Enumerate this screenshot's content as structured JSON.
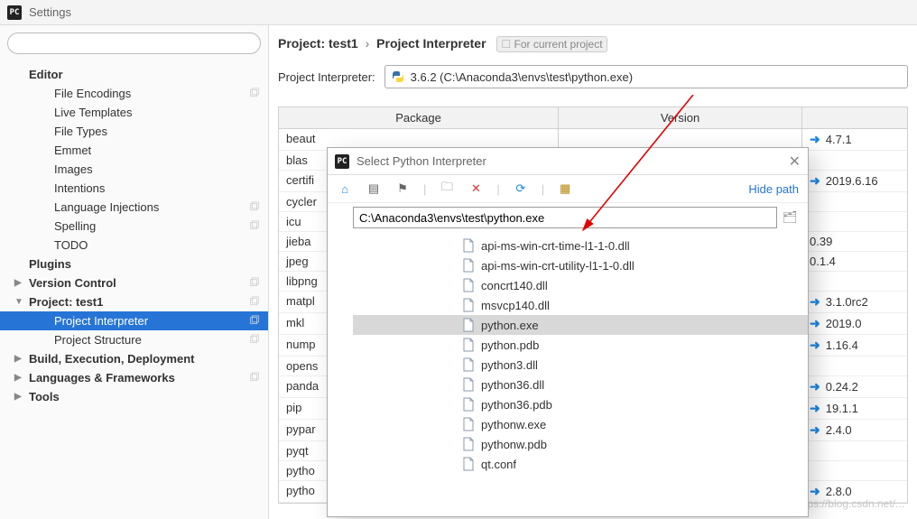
{
  "title": "Settings",
  "sidebar": {
    "items": [
      {
        "label": "Editor",
        "type": "head"
      },
      {
        "label": "File Encodings",
        "type": "child",
        "copy": true
      },
      {
        "label": "Live Templates",
        "type": "child"
      },
      {
        "label": "File Types",
        "type": "child"
      },
      {
        "label": "Emmet",
        "type": "child"
      },
      {
        "label": "Images",
        "type": "child"
      },
      {
        "label": "Intentions",
        "type": "child"
      },
      {
        "label": "Language Injections",
        "type": "child",
        "copy": true
      },
      {
        "label": "Spelling",
        "type": "child",
        "copy": true
      },
      {
        "label": "TODO",
        "type": "child"
      },
      {
        "label": "Plugins",
        "type": "head"
      },
      {
        "label": "Version Control",
        "type": "exp",
        "copy": true
      },
      {
        "label": "Project: test1",
        "type": "open",
        "copy": true
      },
      {
        "label": "Project Interpreter",
        "type": "child",
        "sel": true,
        "copy": true
      },
      {
        "label": "Project Structure",
        "type": "child",
        "copy": true
      },
      {
        "label": "Build, Execution, Deployment",
        "type": "exp"
      },
      {
        "label": "Languages & Frameworks",
        "type": "exp",
        "copy": true
      },
      {
        "label": "Tools",
        "type": "exp"
      }
    ]
  },
  "breadcrumb": {
    "a": "Project: test1",
    "b": "Project Interpreter",
    "badge": "For current project"
  },
  "interp": {
    "label": "Project Interpreter:",
    "value": "3.6.2 (C:\\Anaconda3\\envs\\test\\python.exe)"
  },
  "table": {
    "heads": [
      "Package",
      "Version",
      ""
    ],
    "rows": [
      {
        "pkg": "beaut",
        "ver": "",
        "lat": "4.7.1",
        "arrow": true
      },
      {
        "pkg": "blas",
        "ver": "",
        "lat": ""
      },
      {
        "pkg": "certifi",
        "ver": "",
        "lat": "2019.6.16",
        "arrow": true
      },
      {
        "pkg": "cycler",
        "ver": "",
        "lat": ""
      },
      {
        "pkg": "icu",
        "ver": "",
        "lat": ""
      },
      {
        "pkg": "jieba",
        "ver": "",
        "lat": "0.39"
      },
      {
        "pkg": "jpeg",
        "ver": "",
        "lat": "0.1.4"
      },
      {
        "pkg": "libpng",
        "ver": "",
        "lat": ""
      },
      {
        "pkg": "matpl",
        "ver": "",
        "lat": "3.1.0rc2",
        "arrow": true
      },
      {
        "pkg": "mkl",
        "ver": "",
        "lat": "2019.0",
        "arrow": true
      },
      {
        "pkg": "nump",
        "ver": "",
        "lat": "1.16.4",
        "arrow": true
      },
      {
        "pkg": "opens",
        "ver": "",
        "lat": ""
      },
      {
        "pkg": "panda",
        "ver": "",
        "lat": "0.24.2",
        "arrow": true
      },
      {
        "pkg": "pip",
        "ver": "",
        "lat": "19.1.1",
        "arrow": true
      },
      {
        "pkg": "pypar",
        "ver": "",
        "lat": "2.4.0",
        "arrow": true
      },
      {
        "pkg": "pyqt",
        "ver": "",
        "lat": ""
      },
      {
        "pkg": "pytho",
        "ver": "",
        "lat": ""
      },
      {
        "pkg": "pytho",
        "ver": "",
        "lat": "2.8.0",
        "arrow": true
      }
    ]
  },
  "dialog": {
    "title": "Select Python Interpreter",
    "hide": "Hide path",
    "path": "C:\\Anaconda3\\envs\\test\\python.exe",
    "files": [
      {
        "name": "api-ms-win-crt-time-l1-1-0.dll"
      },
      {
        "name": "api-ms-win-crt-utility-l1-1-0.dll"
      },
      {
        "name": "concrt140.dll"
      },
      {
        "name": "msvcp140.dll"
      },
      {
        "name": "python.exe",
        "sel": true
      },
      {
        "name": "python.pdb"
      },
      {
        "name": "python3.dll"
      },
      {
        "name": "python36.dll"
      },
      {
        "name": "python36.pdb"
      },
      {
        "name": "pythonw.exe"
      },
      {
        "name": "pythonw.pdb"
      },
      {
        "name": "qt.conf"
      }
    ]
  },
  "watermark": "https://blog.csdn.net/..."
}
